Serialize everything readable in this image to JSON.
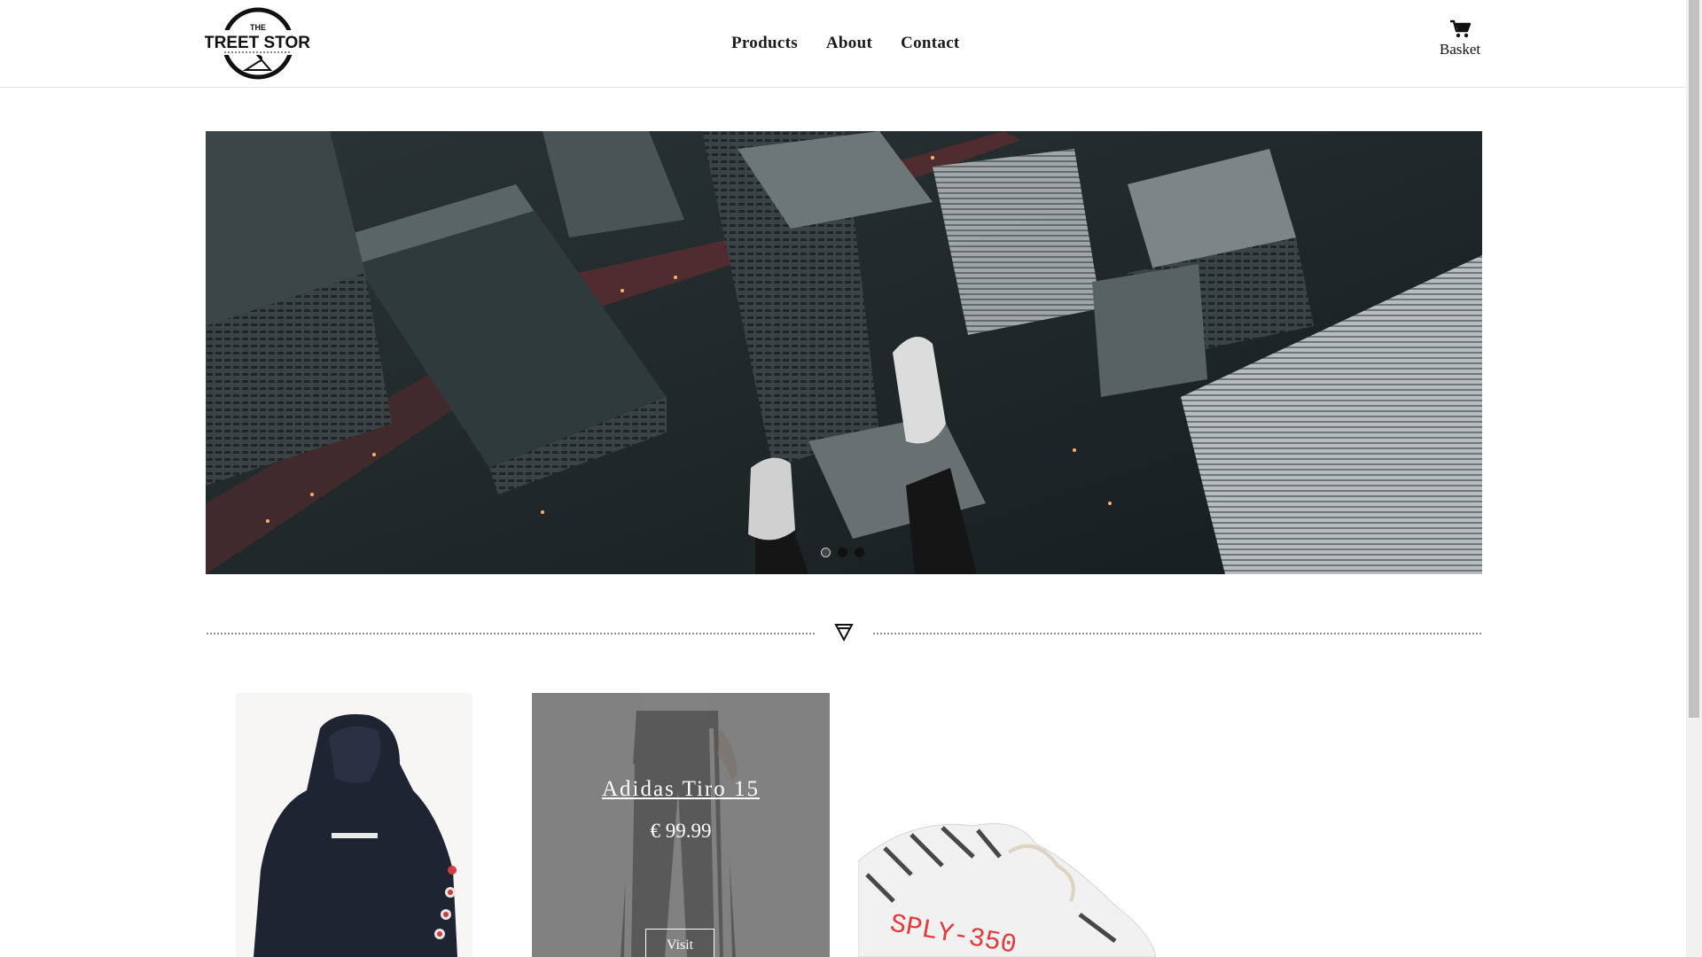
{
  "header": {
    "logo": {
      "top_text": "THE",
      "main_text": "STREET STORE"
    },
    "nav": [
      {
        "label": "Products"
      },
      {
        "label": "About"
      },
      {
        "label": "Contact"
      }
    ],
    "basket": {
      "label": "Basket",
      "icon": "cart-icon"
    }
  },
  "hero": {
    "slide_count": 3,
    "active_slide": 1,
    "description": ""
  },
  "divider": {
    "icon": "filter-triangle-icon"
  },
  "products": [
    {
      "name": "",
      "price": "",
      "image": "hoodie"
    },
    {
      "name": "Adidas Tiro 15",
      "price": "€ 99.99",
      "visit_label": "Visit",
      "image": "track-pants",
      "hovered": true
    },
    {
      "name": "",
      "price": "",
      "image": "sneaker",
      "sneaker_text": "SPLY-350"
    }
  ],
  "colors": {
    "overlay": "#696969",
    "sneaker_text": "#e23a3a"
  }
}
